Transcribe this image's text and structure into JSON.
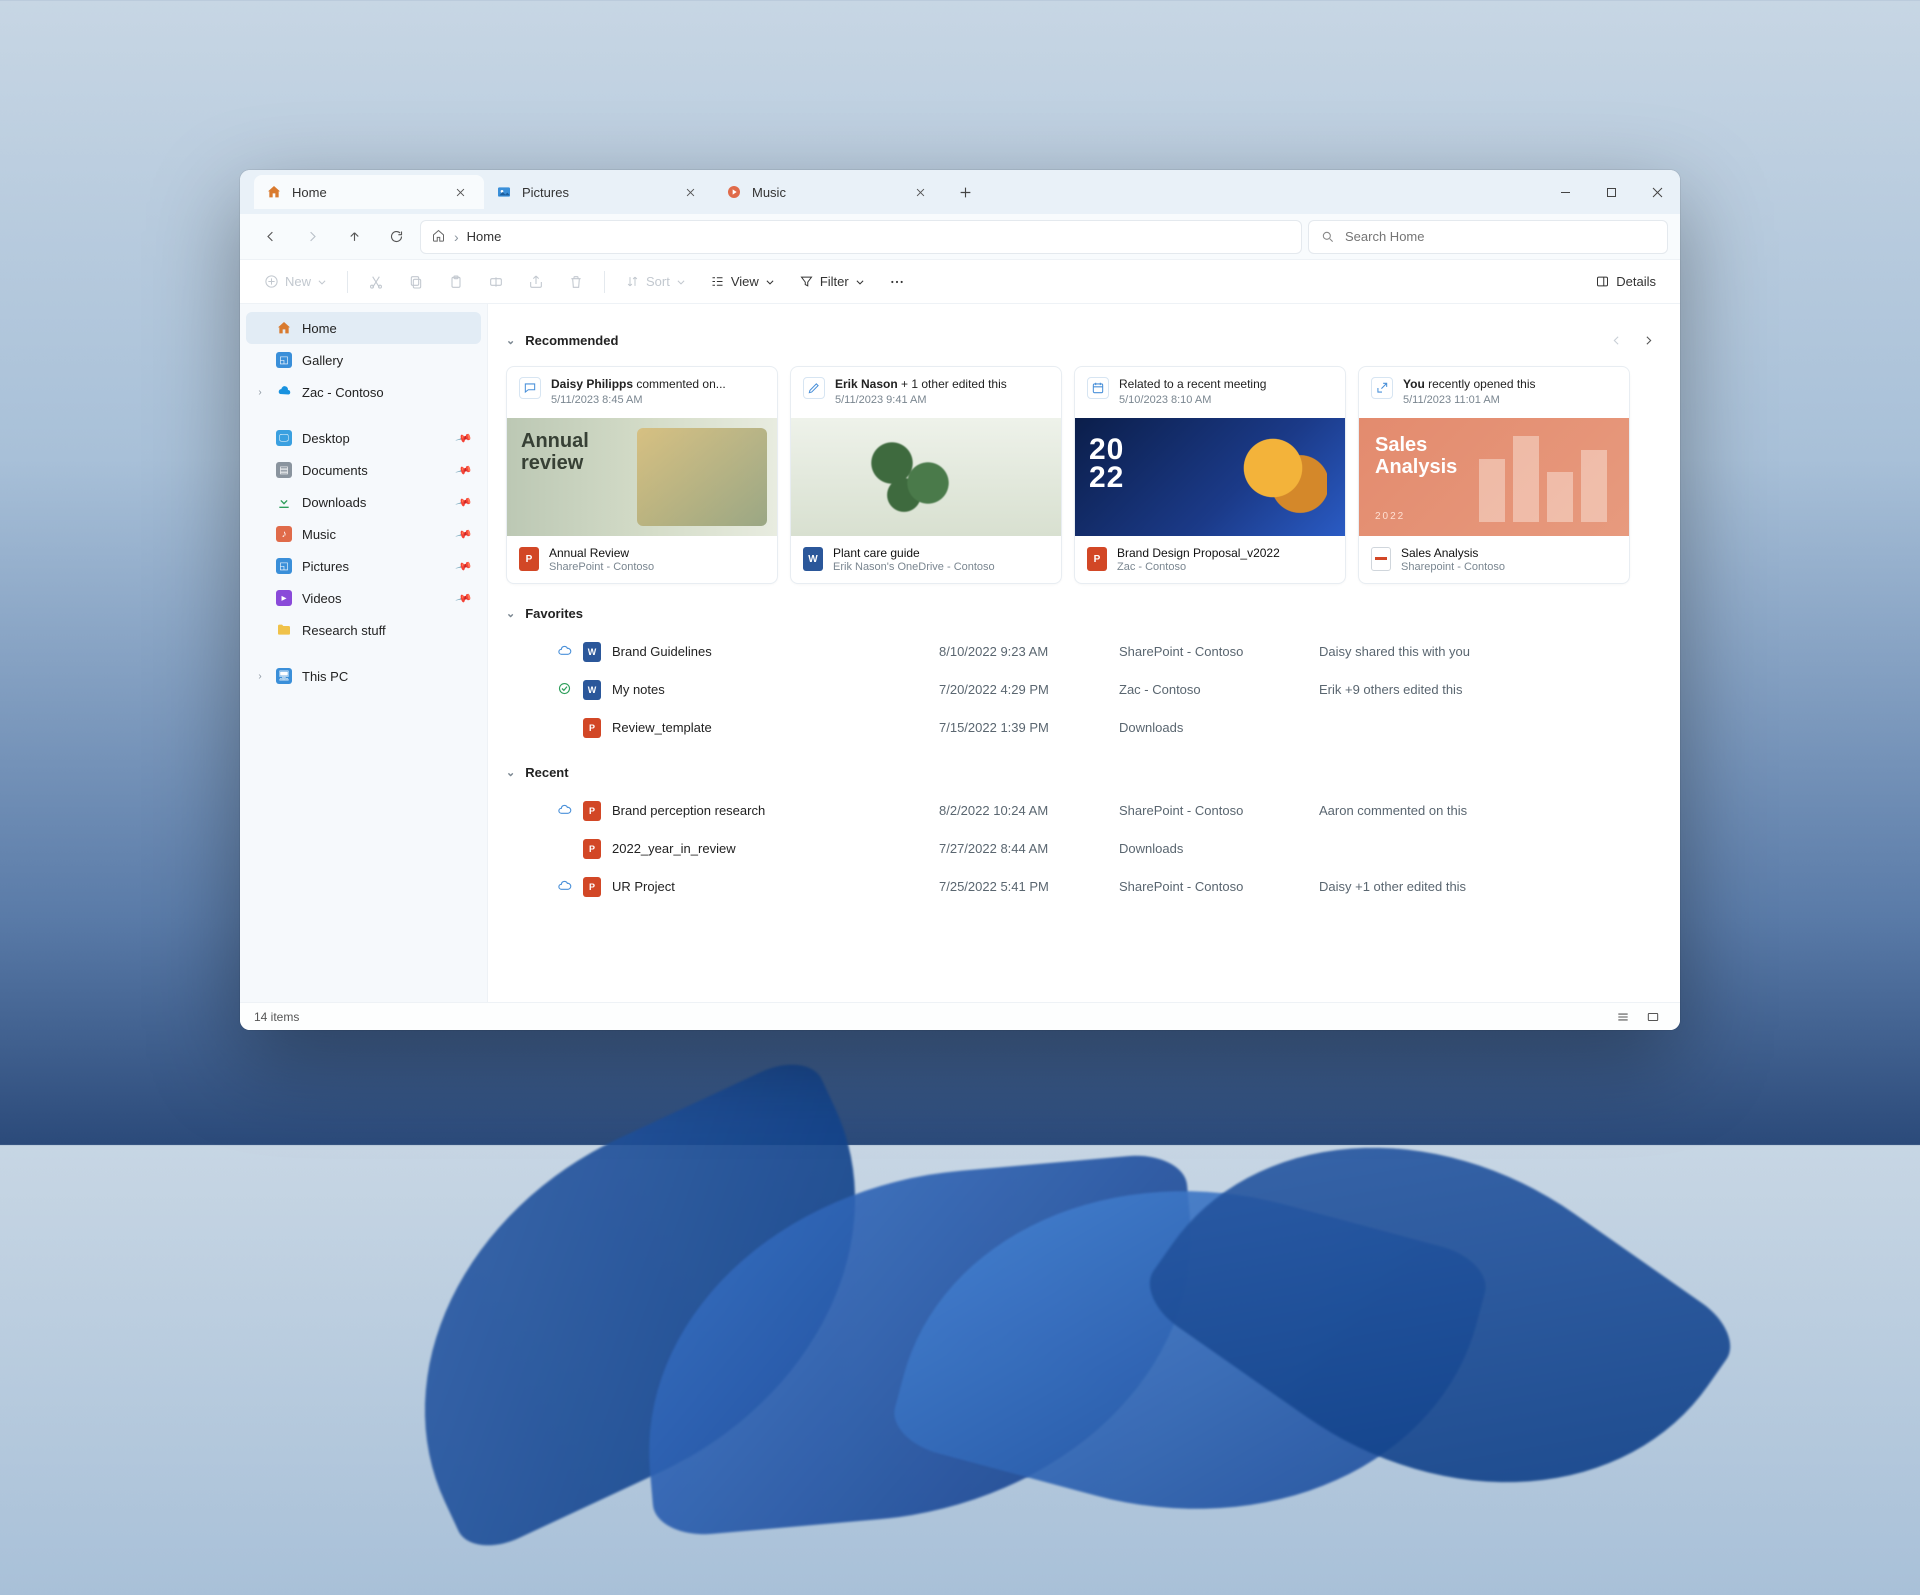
{
  "tabs": [
    {
      "label": "Home",
      "icon": "home-icon",
      "active": true
    },
    {
      "label": "Pictures",
      "icon": "pictures-icon",
      "active": false
    },
    {
      "label": "Music",
      "icon": "music-icon",
      "active": false
    }
  ],
  "breadcrumb": {
    "path_label": "Home"
  },
  "search": {
    "placeholder": "Search Home"
  },
  "toolbar": {
    "new_label": "New",
    "sort_label": "Sort",
    "view_label": "View",
    "filter_label": "Filter",
    "details_label": "Details"
  },
  "sidebar": {
    "items": [
      {
        "label": "Home",
        "icon": "home-icon",
        "active": true
      },
      {
        "label": "Gallery",
        "icon": "gallery-icon"
      },
      {
        "label": "Zac - Contoso",
        "icon": "onedrive-icon",
        "expandable": true
      }
    ],
    "items2": [
      {
        "label": "Desktop",
        "icon": "desktop-icon",
        "pinned": true
      },
      {
        "label": "Documents",
        "icon": "documents-icon",
        "pinned": true
      },
      {
        "label": "Downloads",
        "icon": "downloads-icon",
        "pinned": true
      },
      {
        "label": "Music",
        "icon": "music-icon",
        "pinned": true
      },
      {
        "label": "Pictures",
        "icon": "pictures-icon",
        "pinned": true
      },
      {
        "label": "Videos",
        "icon": "videos-icon",
        "pinned": true
      },
      {
        "label": "Research stuff",
        "icon": "folder-icon"
      }
    ],
    "items3": [
      {
        "label": "This PC",
        "icon": "thispc-icon",
        "expandable": true
      }
    ]
  },
  "sections": {
    "recommended": "Recommended",
    "favorites": "Favorites",
    "recent": "Recent"
  },
  "recommended": [
    {
      "activity_actor": "Daisy Philipps",
      "activity_rest": " commented on...",
      "activity_time": "5/11/2023 8:45 AM",
      "name": "Annual Review",
      "location": "SharePoint - Contoso",
      "doc_type": "ppt"
    },
    {
      "activity_actor": "Erik Nason",
      "activity_rest": " + 1 other edited this",
      "activity_time": "5/11/2023 9:41 AM",
      "name": "Plant care guide",
      "location": "Erik Nason's OneDrive - Contoso",
      "doc_type": "word"
    },
    {
      "activity_actor": "",
      "activity_rest": "Related to a recent meeting",
      "activity_time": "5/10/2023 8:10 AM",
      "name": "Brand Design Proposal_v2022",
      "location": "Zac - Contoso",
      "doc_type": "ppt"
    },
    {
      "activity_actor": "You",
      "activity_rest": " recently opened this",
      "activity_time": "5/11/2023 11:01 AM",
      "name": "Sales Analysis",
      "location": "Sharepoint - Contoso",
      "doc_type": "pdf"
    }
  ],
  "favorites": [
    {
      "sync": "cloud",
      "type": "word",
      "name": "Brand Guidelines",
      "date": "8/10/2022 9:23 AM",
      "location": "SharePoint - Contoso",
      "activity": "Daisy shared this with you"
    },
    {
      "sync": "check",
      "type": "word",
      "name": "My notes",
      "date": "7/20/2022 4:29 PM",
      "location": "Zac - Contoso",
      "activity": "Erik +9 others edited this"
    },
    {
      "sync": "",
      "type": "ppt",
      "name": "Review_template",
      "date": "7/15/2022 1:39 PM",
      "location": "Downloads",
      "activity": ""
    }
  ],
  "recent": [
    {
      "sync": "cloud",
      "type": "ppt",
      "name": "Brand perception research",
      "date": "8/2/2022 10:24 AM",
      "location": "SharePoint - Contoso",
      "activity": "Aaron commented on this"
    },
    {
      "sync": "",
      "type": "ppt",
      "name": "2022_year_in_review",
      "date": "7/27/2022 8:44 AM",
      "location": "Downloads",
      "activity": ""
    },
    {
      "sync": "cloud",
      "type": "ppt",
      "name": "UR Project",
      "date": "7/25/2022 5:41 PM",
      "location": "SharePoint - Contoso",
      "activity": "Daisy +1 other edited this"
    }
  ],
  "statusbar": {
    "count_label": "14 items"
  }
}
